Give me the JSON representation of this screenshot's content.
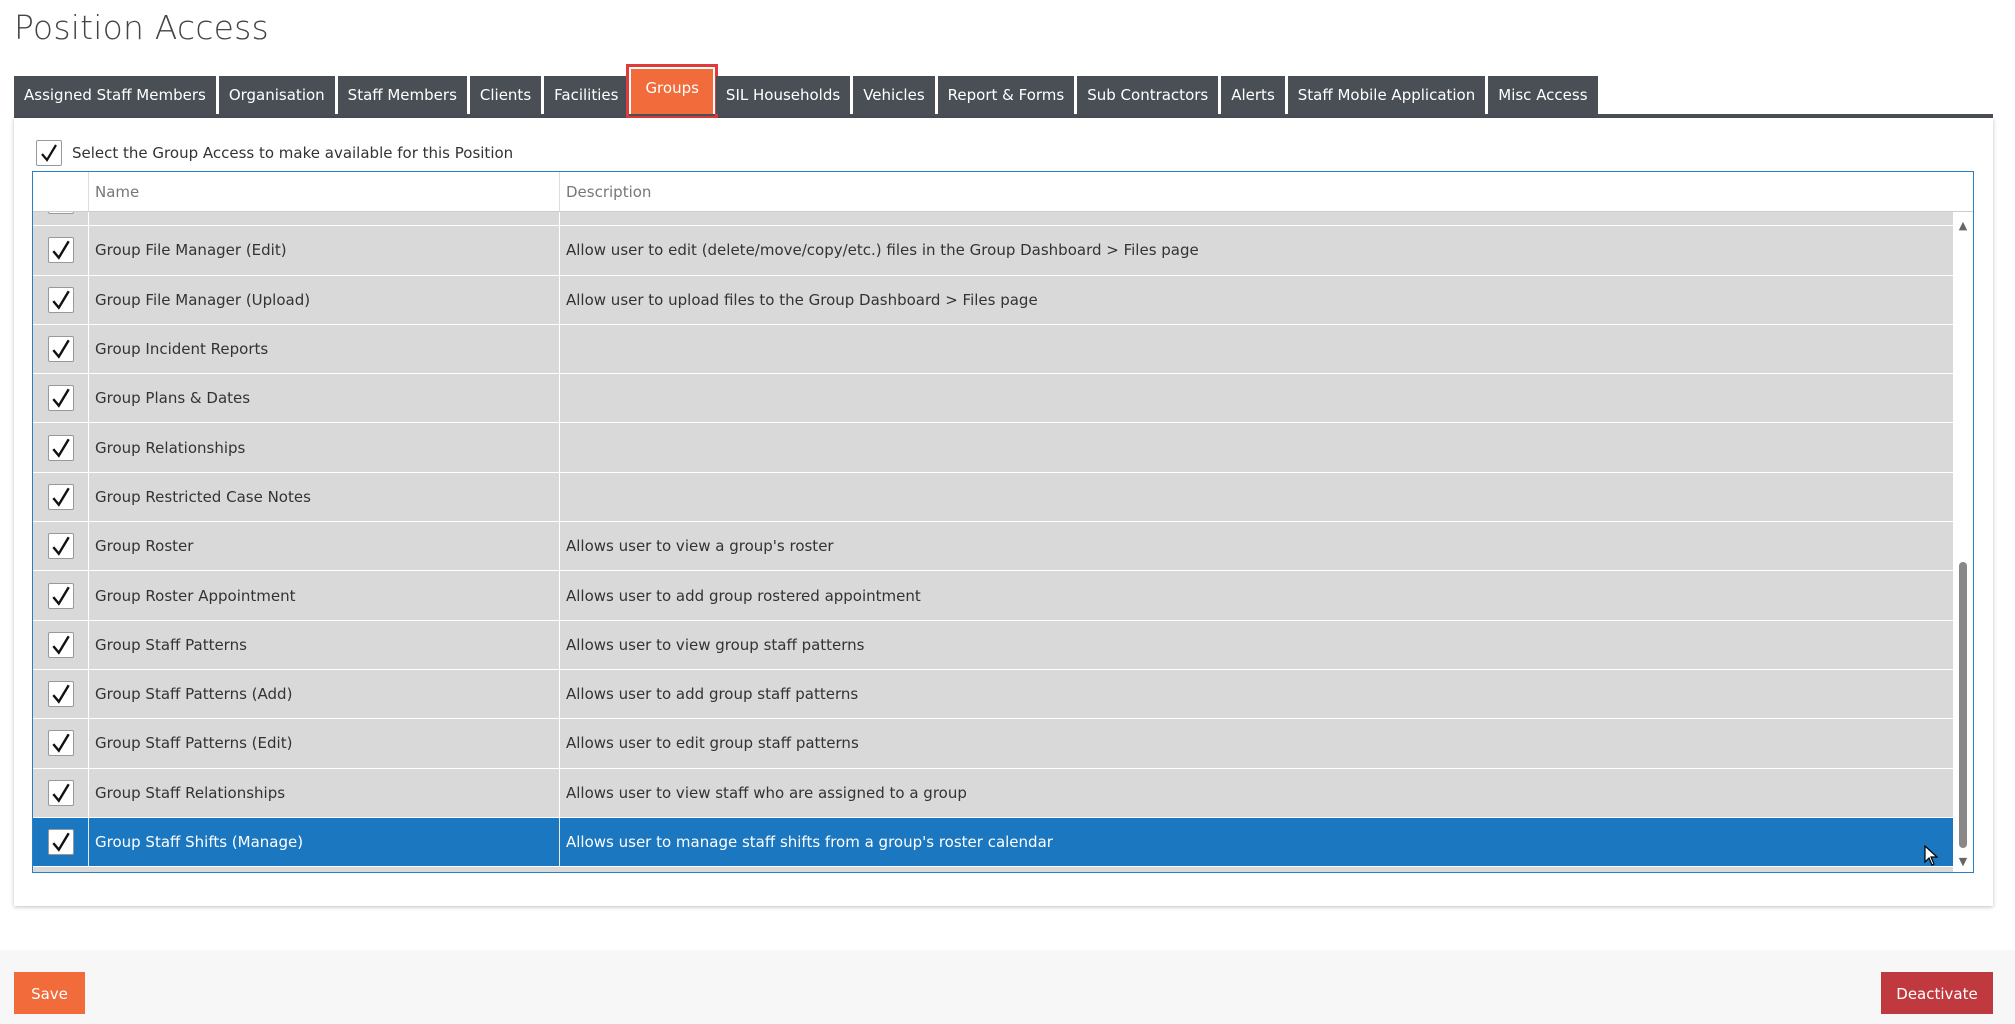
{
  "page": {
    "title": "Position Access"
  },
  "tabs": [
    {
      "label": "Assigned Staff Members",
      "active": false
    },
    {
      "label": "Organisation",
      "active": false
    },
    {
      "label": "Staff Members",
      "active": false
    },
    {
      "label": "Clients",
      "active": false
    },
    {
      "label": "Facilities",
      "active": false
    },
    {
      "label": "Groups",
      "active": true
    },
    {
      "label": "SIL Households",
      "active": false
    },
    {
      "label": "Vehicles",
      "active": false
    },
    {
      "label": "Report & Forms",
      "active": false
    },
    {
      "label": "Sub Contractors",
      "active": false
    },
    {
      "label": "Alerts",
      "active": false
    },
    {
      "label": "Staff Mobile Application",
      "active": false
    },
    {
      "label": "Misc Access",
      "active": false
    }
  ],
  "select_all": {
    "label": "Select the Group Access to make available for this Position",
    "checked": true
  },
  "grid": {
    "columns": {
      "name": "Name",
      "description": "Description"
    },
    "rows": [
      {
        "name": "",
        "description": "",
        "checked": true
      },
      {
        "name": "Group File Manager (Edit)",
        "description": "Allow user to edit (delete/move/copy/etc.) files in the Group Dashboard > Files page",
        "checked": true
      },
      {
        "name": "Group File Manager (Upload)",
        "description": "Allow user to upload files to the Group Dashboard > Files page",
        "checked": true
      },
      {
        "name": "Group Incident Reports",
        "description": "",
        "checked": true
      },
      {
        "name": "Group Plans & Dates",
        "description": "",
        "checked": true
      },
      {
        "name": "Group Relationships",
        "description": "",
        "checked": true
      },
      {
        "name": "Group Restricted Case Notes",
        "description": "",
        "checked": true
      },
      {
        "name": "Group Roster",
        "description": "Allows user to view a group's roster",
        "checked": true
      },
      {
        "name": "Group Roster Appointment",
        "description": "Allows user to add group rostered appointment",
        "checked": true
      },
      {
        "name": "Group Staff Patterns",
        "description": "Allows user to view group staff patterns",
        "checked": true
      },
      {
        "name": "Group Staff Patterns (Add)",
        "description": "Allows user to add group staff patterns",
        "checked": true
      },
      {
        "name": "Group Staff Patterns (Edit)",
        "description": "Allows user to edit group staff patterns",
        "checked": true
      },
      {
        "name": "Group Staff Relationships",
        "description": "Allows user to view staff who are assigned to a group",
        "checked": true
      },
      {
        "name": "Group Staff Shifts (Manage)",
        "description": "Allows user to manage staff shifts from a group's roster calendar",
        "checked": true,
        "selected": true
      }
    ]
  },
  "footer": {
    "save_label": "Save",
    "deactivate_label": "Deactivate"
  },
  "icons": {
    "check": "checkmark-icon",
    "scroll_up": "triangle-up-icon",
    "scroll_down": "triangle-down-icon",
    "cursor": "mouse-pointer-icon"
  },
  "colors": {
    "accent": "#f26b3a",
    "tab_bg": "#4a4f56",
    "selected_row": "#1a77c0",
    "danger": "#c0393f",
    "highlight": "#e03a3a"
  }
}
